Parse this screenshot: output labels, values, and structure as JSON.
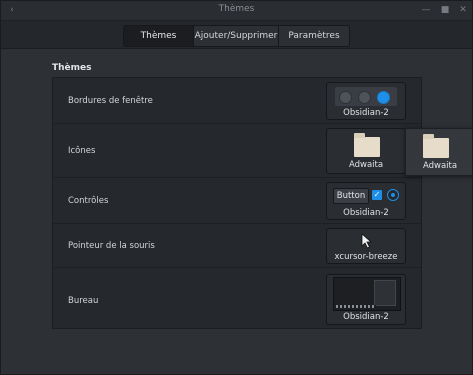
{
  "window": {
    "title": "Thèmes",
    "back_glyph": "‹",
    "minimize_glyph": "—",
    "maximize_glyph": "■",
    "close_glyph": "✕"
  },
  "tabs": [
    {
      "label": "Thèmes",
      "active": true
    },
    {
      "label": "Ajouter/Supprimer",
      "active": false
    },
    {
      "label": "Paramètres",
      "active": false
    }
  ],
  "section": {
    "title": "Thèmes"
  },
  "rows": [
    {
      "label": "Bordures de fenêtre",
      "theme": "Obsidian-2",
      "icon": "window-buttons-preview"
    },
    {
      "label": "Icônes",
      "theme": "Adwaita",
      "icon": "folder-icon"
    },
    {
      "label": "Contrôles",
      "theme": "Obsidian-2",
      "icon": "controls-preview",
      "button_label": "Button"
    },
    {
      "label": "Pointeur de la souris",
      "theme": "xcursor-breeze",
      "icon": "cursor-icon"
    },
    {
      "label": "Bureau",
      "theme": "Obsidian-2",
      "icon": "desktop-preview"
    }
  ],
  "popup": {
    "theme": "Adwaita"
  },
  "colors": {
    "accent": "#1e8fe8",
    "background": "#2d3035",
    "panel": "#25282c"
  }
}
